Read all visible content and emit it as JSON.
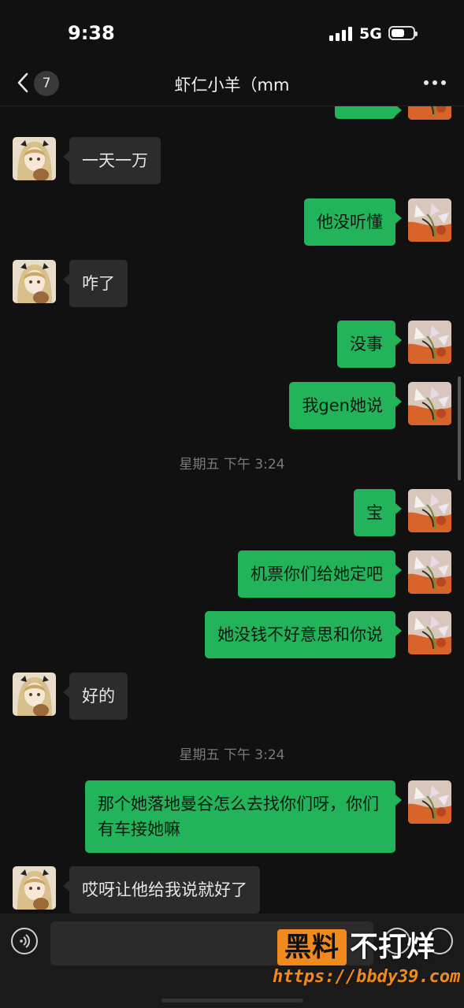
{
  "status_bar": {
    "time": "9:38",
    "network": "5G"
  },
  "nav": {
    "back_count": "7",
    "title": "虾仁小羊（mm"
  },
  "messages": [
    {
      "side": "in",
      "text": "一天一万"
    },
    {
      "side": "out",
      "text": "他没听懂"
    },
    {
      "side": "in",
      "text": "咋了"
    },
    {
      "side": "out",
      "text": "没事"
    },
    {
      "side": "out",
      "text": "我gen她说"
    },
    {
      "side": "out",
      "text": "宝"
    },
    {
      "side": "out",
      "text": "机票你们给她定吧"
    },
    {
      "side": "out",
      "text": "她没钱不好意思和你说"
    },
    {
      "side": "in",
      "text": "好的"
    },
    {
      "side": "out",
      "text": "那个她落地曼谷怎么去找你们呀，你们有车接她嘛"
    },
    {
      "side": "in",
      "text": "哎呀让他给我说就好了"
    }
  ],
  "timestamps": [
    "星期五 下午 3:24",
    "星期五 下午 3:24"
  ],
  "watermark": {
    "logo": "黑料",
    "text": "不打烊",
    "url": "https://bbdy39.com"
  },
  "colors": {
    "background": "#111111",
    "incoming_bubble": "#2c2c2c",
    "outgoing_bubble": "#23b35a",
    "watermark_accent": "#f08a1c"
  },
  "icons": {
    "back": "chevron-left-icon",
    "more": "more-dots-icon",
    "voice": "voice-icon",
    "emoji": "emoji-icon",
    "plus": "plus-icon"
  }
}
